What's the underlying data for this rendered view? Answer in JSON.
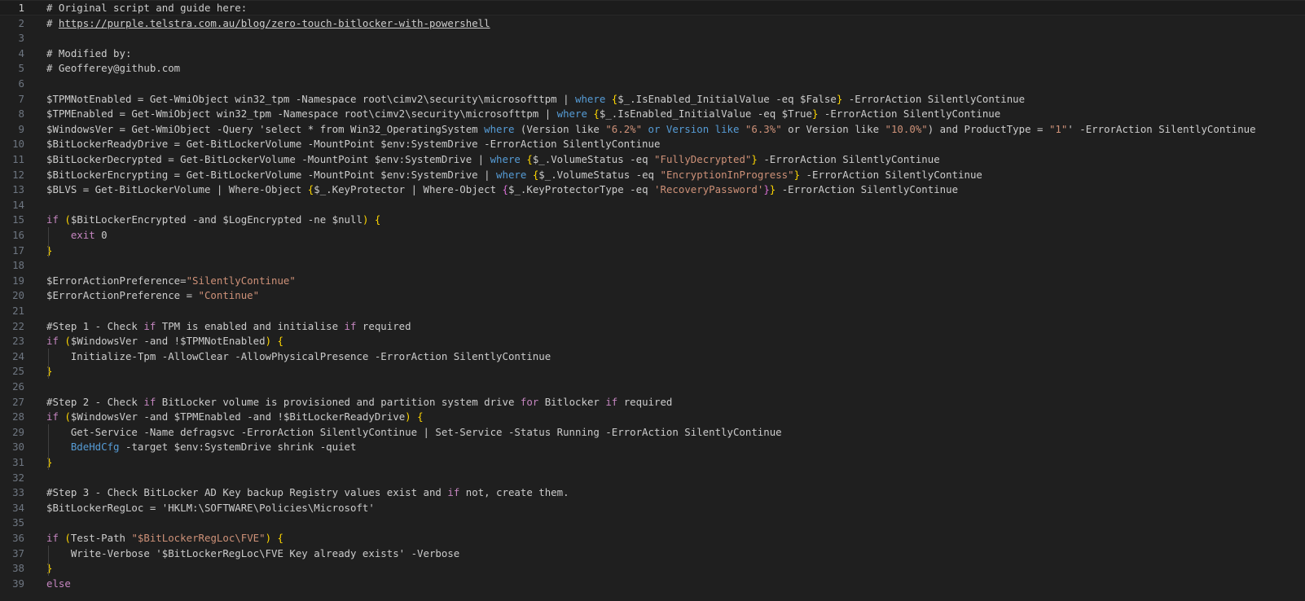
{
  "editor": {
    "language": "powershell",
    "lines": [
      {
        "n": "1",
        "tokens": [
          {
            "t": "# Original script and guide here:",
            "c": "t-comment"
          }
        ]
      },
      {
        "n": "2",
        "tokens": [
          {
            "t": "# ",
            "c": "t-comment"
          },
          {
            "t": "https://purple.telstra.com.au/blog/zero-touch-bitlocker-with-powershell",
            "c": "t-comment t-link"
          }
        ]
      },
      {
        "n": "3",
        "tokens": []
      },
      {
        "n": "4",
        "tokens": [
          {
            "t": "# Modified by:",
            "c": "t-comment"
          }
        ]
      },
      {
        "n": "5",
        "tokens": [
          {
            "t": "# Geofferey@github.com",
            "c": "t-comment"
          }
        ]
      },
      {
        "n": "6",
        "tokens": []
      },
      {
        "n": "7",
        "tokens": [
          {
            "t": "$TPMNotEnabled = Get-WmiObject win32_tpm -Namespace root\\cimv2\\security\\microsofttpm | ",
            "c": ""
          },
          {
            "t": "where",
            "c": "t-blue"
          },
          {
            "t": " ",
            "c": ""
          },
          {
            "t": "{",
            "c": "t-brace"
          },
          {
            "t": "$_.IsEnabled_InitialValue -eq $False",
            "c": ""
          },
          {
            "t": "}",
            "c": "t-brace"
          },
          {
            "t": " -ErrorAction SilentlyContinue",
            "c": ""
          }
        ]
      },
      {
        "n": "8",
        "tokens": [
          {
            "t": "$TPMEnabled = Get-WmiObject win32_tpm -Namespace root\\cimv2\\security\\microsofttpm | ",
            "c": ""
          },
          {
            "t": "where",
            "c": "t-blue"
          },
          {
            "t": " ",
            "c": ""
          },
          {
            "t": "{",
            "c": "t-brace"
          },
          {
            "t": "$_.IsEnabled_InitialValue -eq $True",
            "c": ""
          },
          {
            "t": "}",
            "c": "t-brace"
          },
          {
            "t": " -ErrorAction SilentlyContinue",
            "c": ""
          }
        ]
      },
      {
        "n": "9",
        "tokens": [
          {
            "t": "$WindowsVer = Get-WmiObject -Query 'select * from Win32_OperatingSystem ",
            "c": ""
          },
          {
            "t": "where",
            "c": "t-blue"
          },
          {
            "t": " (Version like ",
            "c": ""
          },
          {
            "t": "\"6.2%\"",
            "c": "t-str"
          },
          {
            "t": " or Version like ",
            "c": "t-blue"
          },
          {
            "t": "\"6.3%\"",
            "c": "t-str"
          },
          {
            "t": " or Version like ",
            "c": ""
          },
          {
            "t": "\"10.0%\"",
            "c": "t-str"
          },
          {
            "t": ") and ProductType = ",
            "c": ""
          },
          {
            "t": "\"1\"",
            "c": "t-str"
          },
          {
            "t": "' -ErrorAction SilentlyContinue",
            "c": ""
          }
        ]
      },
      {
        "n": "10",
        "tokens": [
          {
            "t": "$BitLockerReadyDrive = Get-BitLockerVolume -MountPoint $env:SystemDrive -ErrorAction SilentlyContinue",
            "c": ""
          }
        ]
      },
      {
        "n": "11",
        "tokens": [
          {
            "t": "$BitLockerDecrypted = Get-BitLockerVolume -MountPoint $env:SystemDrive | ",
            "c": ""
          },
          {
            "t": "where",
            "c": "t-blue"
          },
          {
            "t": " ",
            "c": ""
          },
          {
            "t": "{",
            "c": "t-brace"
          },
          {
            "t": "$_.VolumeStatus -eq ",
            "c": ""
          },
          {
            "t": "\"FullyDecrypted\"",
            "c": "t-str"
          },
          {
            "t": "}",
            "c": "t-brace"
          },
          {
            "t": " -ErrorAction SilentlyContinue",
            "c": ""
          }
        ]
      },
      {
        "n": "12",
        "tokens": [
          {
            "t": "$BitLockerEncrypting = Get-BitLockerVolume -MountPoint $env:SystemDrive | ",
            "c": ""
          },
          {
            "t": "where",
            "c": "t-blue"
          },
          {
            "t": " ",
            "c": ""
          },
          {
            "t": "{",
            "c": "t-brace"
          },
          {
            "t": "$_.VolumeStatus -eq ",
            "c": ""
          },
          {
            "t": "\"EncryptionInProgress\"",
            "c": "t-str"
          },
          {
            "t": "}",
            "c": "t-brace"
          },
          {
            "t": " -ErrorAction SilentlyContinue",
            "c": ""
          }
        ]
      },
      {
        "n": "13",
        "tokens": [
          {
            "t": "$BLVS = Get-BitLockerVolume | Where-Object ",
            "c": ""
          },
          {
            "t": "{",
            "c": "t-brace"
          },
          {
            "t": "$_.KeyProtector | Where-Object ",
            "c": ""
          },
          {
            "t": "{",
            "c": "t-brace2"
          },
          {
            "t": "$_.KeyProtectorType -eq ",
            "c": ""
          },
          {
            "t": "'RecoveryPassword'",
            "c": "t-str"
          },
          {
            "t": "}",
            "c": "t-brace2"
          },
          {
            "t": "}",
            "c": "t-brace"
          },
          {
            "t": " -ErrorAction SilentlyContinue",
            "c": ""
          }
        ]
      },
      {
        "n": "14",
        "tokens": []
      },
      {
        "n": "15",
        "tokens": [
          {
            "t": "if",
            "c": "t-kw"
          },
          {
            "t": " ",
            "c": ""
          },
          {
            "t": "(",
            "c": "t-brace"
          },
          {
            "t": "$BitLockerEncrypted -and $LogEncrypted -ne $null",
            "c": ""
          },
          {
            "t": ")",
            "c": "t-brace"
          },
          {
            "t": " ",
            "c": ""
          },
          {
            "t": "{",
            "c": "t-brace"
          }
        ]
      },
      {
        "n": "16",
        "tokens": [
          {
            "t": "    ",
            "c": ""
          },
          {
            "t": "exit",
            "c": "t-kw"
          },
          {
            "t": " 0",
            "c": ""
          }
        ]
      },
      {
        "n": "17",
        "tokens": [
          {
            "t": "}",
            "c": "t-brace"
          }
        ]
      },
      {
        "n": "18",
        "tokens": []
      },
      {
        "n": "19",
        "tokens": [
          {
            "t": "$ErrorActionPreference=",
            "c": ""
          },
          {
            "t": "\"SilentlyContinue\"",
            "c": "t-str"
          }
        ]
      },
      {
        "n": "20",
        "tokens": [
          {
            "t": "$ErrorActionPreference = ",
            "c": ""
          },
          {
            "t": "\"Continue\"",
            "c": "t-str"
          }
        ]
      },
      {
        "n": "21",
        "tokens": []
      },
      {
        "n": "22",
        "tokens": [
          {
            "t": "#Step 1 - Check ",
            "c": ""
          },
          {
            "t": "if",
            "c": "t-kw"
          },
          {
            "t": " TPM is enabled and initialise ",
            "c": ""
          },
          {
            "t": "if",
            "c": "t-kw"
          },
          {
            "t": " required",
            "c": ""
          }
        ]
      },
      {
        "n": "23",
        "tokens": [
          {
            "t": "if",
            "c": "t-kw"
          },
          {
            "t": " ",
            "c": ""
          },
          {
            "t": "(",
            "c": "t-brace"
          },
          {
            "t": "$WindowsVer -and !$TPMNotEnabled",
            "c": ""
          },
          {
            "t": ")",
            "c": "t-brace"
          },
          {
            "t": " ",
            "c": ""
          },
          {
            "t": "{",
            "c": "t-brace"
          }
        ]
      },
      {
        "n": "24",
        "tokens": [
          {
            "t": "    Initialize-Tpm -AllowClear -AllowPhysicalPresence -ErrorAction SilentlyContinue",
            "c": ""
          }
        ]
      },
      {
        "n": "25",
        "tokens": [
          {
            "t": "}",
            "c": "t-brace"
          }
        ]
      },
      {
        "n": "26",
        "tokens": []
      },
      {
        "n": "27",
        "tokens": [
          {
            "t": "#Step 2 - Check ",
            "c": ""
          },
          {
            "t": "if",
            "c": "t-kw"
          },
          {
            "t": " BitLocker volume is provisioned and partition system drive ",
            "c": ""
          },
          {
            "t": "for",
            "c": "t-kw"
          },
          {
            "t": " Bitlocker ",
            "c": ""
          },
          {
            "t": "if",
            "c": "t-kw"
          },
          {
            "t": " required",
            "c": ""
          }
        ]
      },
      {
        "n": "28",
        "tokens": [
          {
            "t": "if",
            "c": "t-kw"
          },
          {
            "t": " ",
            "c": ""
          },
          {
            "t": "(",
            "c": "t-brace"
          },
          {
            "t": "$WindowsVer -and $TPMEnabled -and !$BitLockerReadyDrive",
            "c": ""
          },
          {
            "t": ")",
            "c": "t-brace"
          },
          {
            "t": " ",
            "c": ""
          },
          {
            "t": "{",
            "c": "t-brace"
          }
        ]
      },
      {
        "n": "29",
        "tokens": [
          {
            "t": "    Get-Service -Name defragsvc -ErrorAction SilentlyContinue | Set-Service -Status Running -ErrorAction SilentlyContinue",
            "c": ""
          }
        ]
      },
      {
        "n": "30",
        "tokens": [
          {
            "t": "    ",
            "c": ""
          },
          {
            "t": "BdeHdCfg",
            "c": "t-blue"
          },
          {
            "t": " -target $env:SystemDrive shrink -quiet",
            "c": ""
          }
        ]
      },
      {
        "n": "31",
        "tokens": [
          {
            "t": "}",
            "c": "t-brace"
          }
        ]
      },
      {
        "n": "32",
        "tokens": []
      },
      {
        "n": "33",
        "tokens": [
          {
            "t": "#Step 3 - Check BitLocker AD Key backup Registry values exist and ",
            "c": ""
          },
          {
            "t": "if",
            "c": "t-kw"
          },
          {
            "t": " not, create them.",
            "c": ""
          }
        ]
      },
      {
        "n": "34",
        "tokens": [
          {
            "t": "$BitLockerRegLoc = 'HKLM:\\SOFTWARE\\Policies\\Microsoft'",
            "c": ""
          }
        ]
      },
      {
        "n": "35",
        "tokens": []
      },
      {
        "n": "36",
        "tokens": [
          {
            "t": "if",
            "c": "t-kw"
          },
          {
            "t": " ",
            "c": ""
          },
          {
            "t": "(",
            "c": "t-brace"
          },
          {
            "t": "Test-Path ",
            "c": ""
          },
          {
            "t": "\"$BitLockerRegLoc\\FVE\"",
            "c": "t-str"
          },
          {
            "t": ")",
            "c": "t-brace"
          },
          {
            "t": " ",
            "c": ""
          },
          {
            "t": "{",
            "c": "t-brace"
          }
        ]
      },
      {
        "n": "37",
        "tokens": [
          {
            "t": "    Write-Verbose '$BitLockerRegLoc\\FVE Key already exists' -Verbose",
            "c": ""
          }
        ]
      },
      {
        "n": "38",
        "tokens": [
          {
            "t": "}",
            "c": "t-brace"
          }
        ]
      },
      {
        "n": "39",
        "tokens": [
          {
            "t": "else",
            "c": "t-kw"
          }
        ]
      }
    ]
  }
}
